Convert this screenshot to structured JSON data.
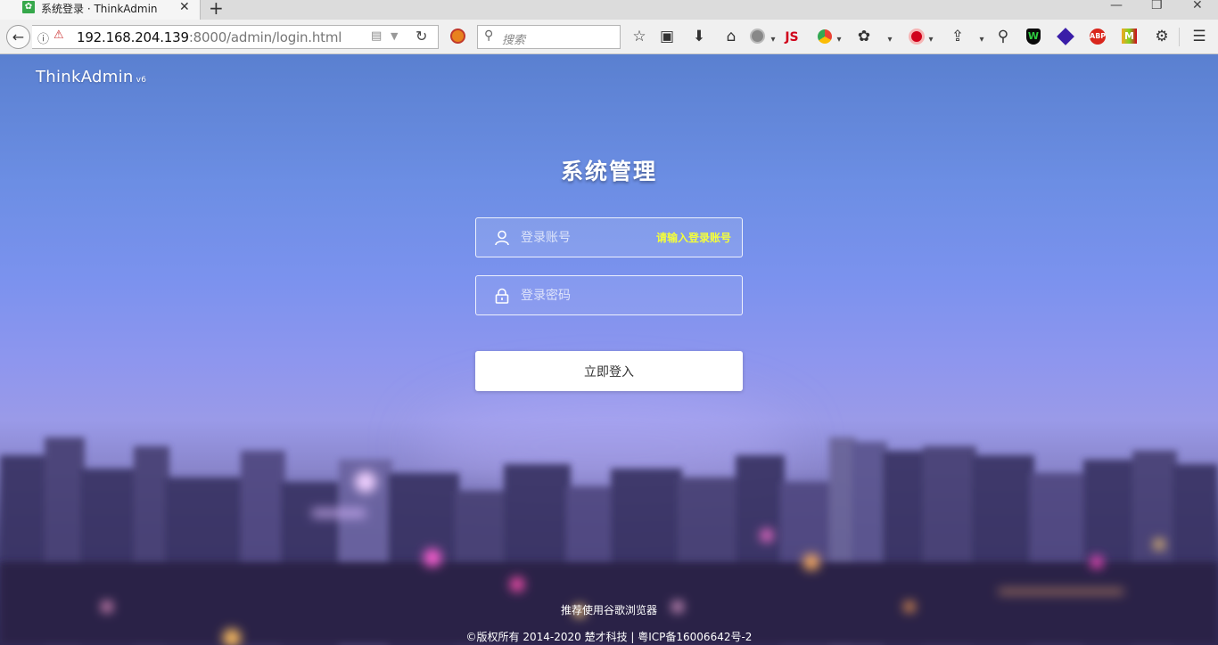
{
  "browser": {
    "tab_title": "系统登录 · ThinkAdmin",
    "tab_close": "✕",
    "new_tab": "+",
    "url_host": "192.168.204.139",
    "url_rest": ":8000/admin/login.html",
    "search_placeholder": "搜索",
    "toolbar_icons": [
      "bookmark-star-icon",
      "reading-list-icon",
      "download-icon",
      "home-icon",
      "extension-icon",
      "js-icon",
      "chrome-icon",
      "palette-icon",
      "red-extension-icon",
      "share-icon",
      "zoom-icon",
      "shield-icon",
      "diamond-icon",
      "adblock-plus-icon",
      "m-extension-icon",
      "settings-icon",
      "menu-icon"
    ],
    "abp_label": "ABP",
    "js_label": "JS",
    "m_label": "M",
    "shield_label": "W"
  },
  "page": {
    "brand": "ThinkAdmin",
    "brand_version": "v6",
    "title": "系统管理",
    "username_placeholder": "登录账号",
    "username_tip": "请输入登录账号",
    "password_placeholder": "登录密码",
    "login_button": "立即登入",
    "recommend": "推荐使用谷歌浏览器",
    "copyright": "©版权所有 2014-2020 楚才科技 | 粤ICP备16006642号-2"
  },
  "colors": {
    "tip_yellow": "#f4ff3a",
    "sky_top": "#5a80d0",
    "sky_mid": "#8e96ee"
  }
}
